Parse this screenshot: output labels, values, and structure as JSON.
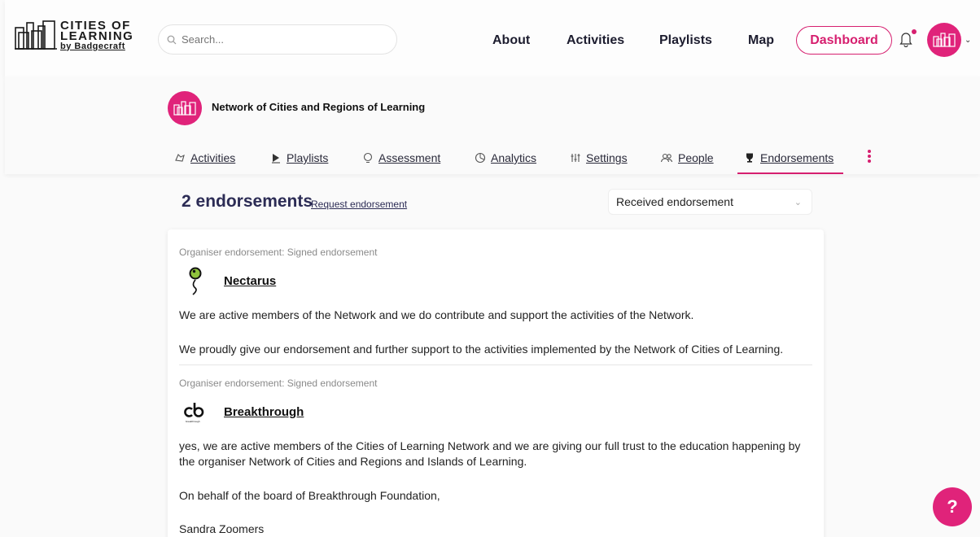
{
  "header": {
    "logo": {
      "line1": "CITIES OF",
      "line2": "LEARNING",
      "line3": "by Badgecraft"
    },
    "search": {
      "placeholder": "Search..."
    },
    "nav": [
      "About",
      "Activities",
      "Playlists",
      "Map"
    ],
    "dashboard_label": "Dashboard",
    "notification_dot": true
  },
  "org": {
    "name": "Network of Cities and Regions of Learning",
    "tabs": [
      {
        "label": "Activities",
        "icon": "activities-icon"
      },
      {
        "label": "Playlists",
        "icon": "play-icon"
      },
      {
        "label": "Assessment",
        "icon": "assessment-icon"
      },
      {
        "label": "Analytics",
        "icon": "analytics-icon"
      },
      {
        "label": "Settings",
        "icon": "sliders-icon"
      },
      {
        "label": "People",
        "icon": "people-icon"
      },
      {
        "label": "Endorsements",
        "icon": "trophy-icon",
        "active": true
      }
    ]
  },
  "endorsements": {
    "count_title": "2 endorsements",
    "request_link": "Request endorsement",
    "filter_value": "Received endorsement",
    "items": [
      {
        "label": "Organiser endorsement: Signed endorsement",
        "name": "Nectarus",
        "paragraphs": [
          "We are active members of the Network and we do contribute and support the activities of the Network.",
          "We proudly give our endorsement and further support to the activities implemented by the Network of Cities of Learning."
        ]
      },
      {
        "label": "Organiser endorsement: Signed endorsement",
        "name": "Breakthrough",
        "logo_caption": "breakthrough",
        "paragraphs": [
          "yes, we are active members of the Cities of Learning Network and we are giving our full trust to the education happening by the organiser Network of Cities and Regions and Islands of Learning.",
          "On behalf of the board of Breakthrough Foundation,",
          "Sandra Zoomers"
        ]
      }
    ]
  },
  "help_label": "?",
  "colors": {
    "accent": "#d61f6f",
    "heading": "#2c2c55"
  }
}
